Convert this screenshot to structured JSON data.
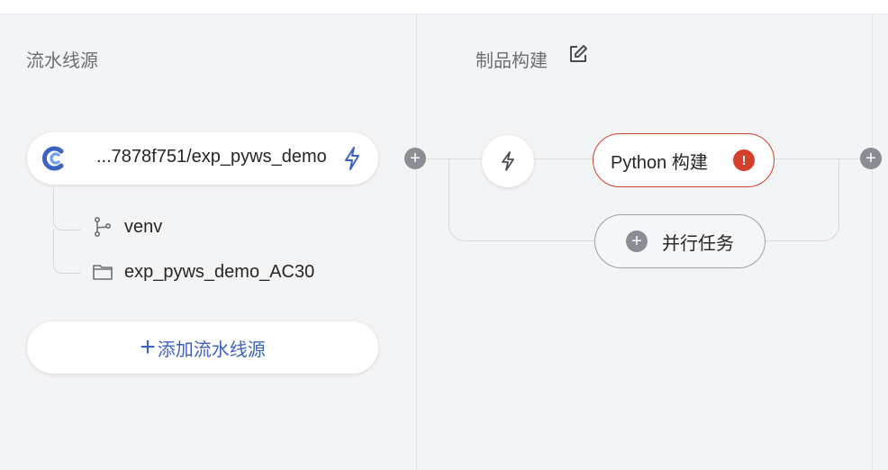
{
  "stages": {
    "sources": {
      "title": "流水线源"
    },
    "build": {
      "title": "制品构建"
    }
  },
  "source": {
    "name": "...7878f751/exp_pyws_demo",
    "logo_icon": "coding-logo-icon",
    "trigger_icon": "lightning-icon",
    "branch": "venv",
    "branch_icon": "git-branch-icon",
    "directory": "exp_pyws_demo_AC30",
    "directory_icon": "folder-icon"
  },
  "add_source": {
    "plus": "+",
    "label": "添加流水线源"
  },
  "build": {
    "trigger_icon": "lightning-icon",
    "task_label": "Python 构建",
    "task_error": "!",
    "parallel_label": "并行任务"
  },
  "plus_glyph": "+",
  "colors": {
    "accent": "#3f62c0",
    "error": "#d3402c",
    "background": "#f3f4f6"
  }
}
